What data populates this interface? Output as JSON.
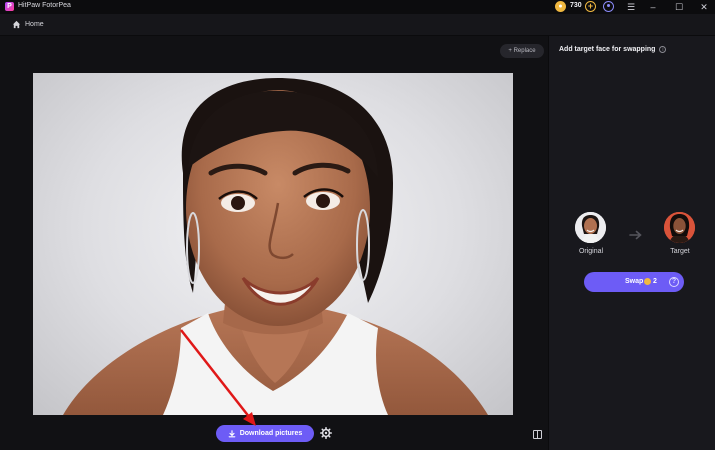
{
  "app": {
    "title": "HitPaw FotorPea",
    "logo_letter": "P"
  },
  "coins": {
    "count": "730",
    "icon": "coin-icon"
  },
  "window_controls": {
    "menu": "☰",
    "minimize": "–",
    "maximize": "☐",
    "close": "✕"
  },
  "breadcrumb": {
    "home_label": "Home"
  },
  "canvas": {
    "replace_label": "Replace",
    "download_label": "Download pictures"
  },
  "panel": {
    "title": "Add target face for swapping",
    "original_label": "Original",
    "target_label": "Target",
    "swap_label": "Swap",
    "swap_cost": "2",
    "help": "?"
  },
  "colors": {
    "accent": "#6d5cf6",
    "coin": "#f0b840",
    "annotation_arrow": "#e01818",
    "background": "#111114"
  }
}
